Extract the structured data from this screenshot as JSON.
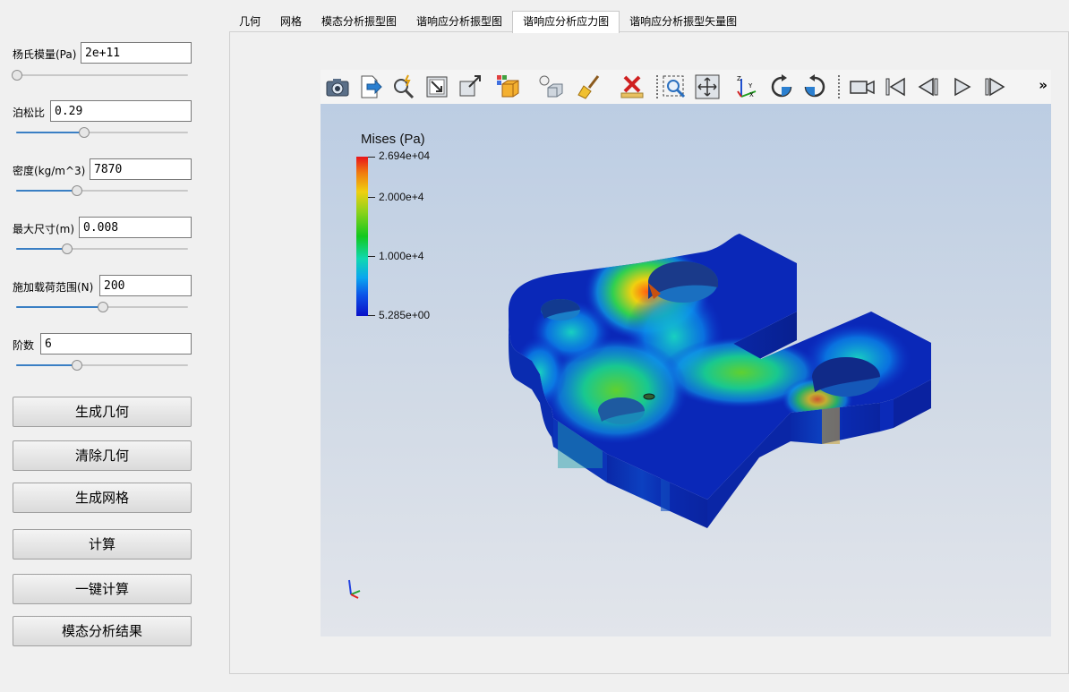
{
  "params": [
    {
      "label": "杨氏模量(Pa)",
      "value": "2e+11",
      "slider_fraction": 0.0
    },
    {
      "label": "泊松比",
      "value": "0.29",
      "slider_fraction": 0.39
    },
    {
      "label": "密度(kg/m^3)",
      "value": "7870",
      "slider_fraction": 0.35
    },
    {
      "label": "最大尺寸(m)",
      "value": "0.008",
      "slider_fraction": 0.29
    },
    {
      "label": "施加载荷范围(N)",
      "value": "200",
      "slider_fraction": 0.5
    },
    {
      "label": "阶数",
      "value": "6",
      "slider_fraction": 0.35
    }
  ],
  "buttons": {
    "gen_geometry": "生成几何",
    "clear_geometry": "清除几何",
    "gen_mesh": "生成网格",
    "compute": "计算",
    "one_click": "一键计算",
    "modal_result": "模态分析结果"
  },
  "tabs": [
    "几何",
    "网格",
    "模态分析振型图",
    "谐响应分析振型图",
    "谐响应分析应力图",
    "谐响应分析振型矢量图"
  ],
  "active_tab_index": 4,
  "toolbar": {
    "icons": [
      "camera-icon",
      "export-icon",
      "magic-zoom-icon",
      "reset-view-icon",
      "zoom-box-icon",
      "parallel-projection-icon",
      "light-icon",
      "clear-icon",
      "remove-icon",
      "zoom-to-box-icon",
      "fit-view-icon",
      "axes-orientation-icon",
      "rotate-cw-icon",
      "rotate-ccw-icon",
      "camera-video-icon",
      "first-frame-icon",
      "prev-frame-icon",
      "play-icon",
      "next-frame-icon"
    ],
    "more": "»"
  },
  "legend": {
    "title": "Mises (Pa)",
    "max": "2.694e+04",
    "ticks": [
      "2.000e+4",
      "1.000e+4"
    ],
    "min": "5.285e+00",
    "colors": [
      "#e8131a",
      "#f0d010",
      "#12c81e",
      "#0aa6ef",
      "#0a10c8"
    ]
  }
}
